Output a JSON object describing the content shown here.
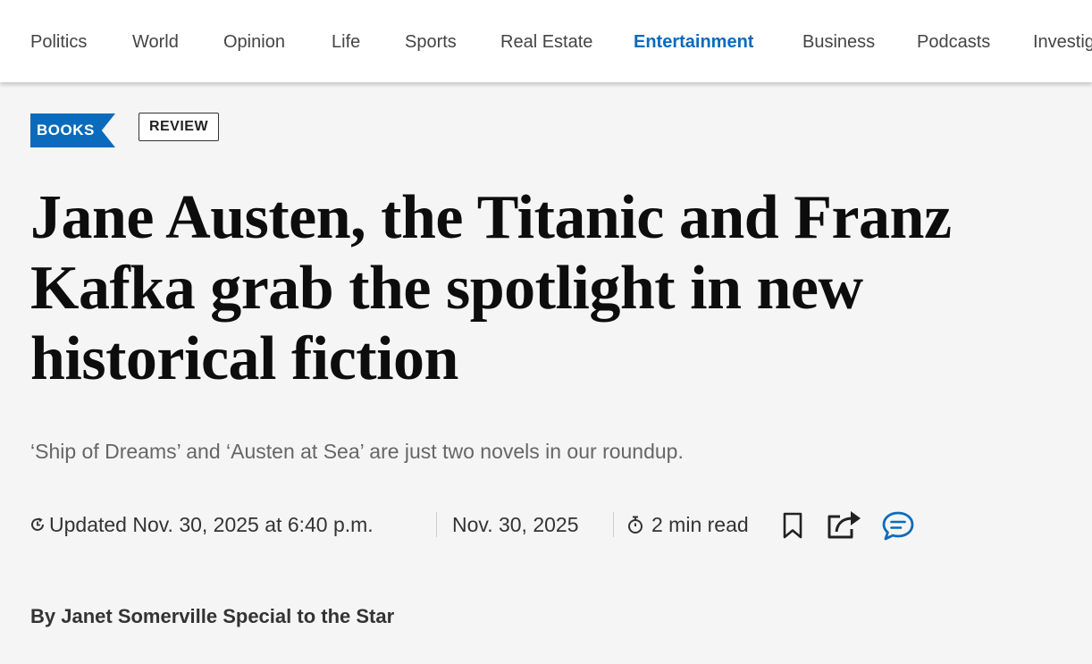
{
  "nav": {
    "items": [
      {
        "label": "Politics"
      },
      {
        "label": "World"
      },
      {
        "label": "Opinion"
      },
      {
        "label": "Life"
      },
      {
        "label": "Sports"
      },
      {
        "label": "Real Estate"
      },
      {
        "label": "Entertainment",
        "active": true
      },
      {
        "label": "Business"
      },
      {
        "label": "Podcasts"
      },
      {
        "label": "Investig"
      }
    ]
  },
  "article": {
    "section_tag": "BOOKS",
    "type_tag": "REVIEW",
    "headline_lines": [
      "Jane Austen, the Titanic and Franz",
      "Kafka grab the spotlight in new",
      "historical fiction"
    ],
    "dek": "‘Ship of Dreams’ and ‘Austen at Sea’ are just two novels in our roundup.",
    "meta": {
      "updated": "Updated Nov. 30, 2025 at 6:40 p.m.",
      "published": "Nov. 30, 2025",
      "read_time": "2 min read"
    },
    "byline": "By Janet Somerville Special to the Star"
  },
  "icons": {
    "updated": "refresh-clock-icon",
    "read_time": "stopwatch-icon",
    "bookmark": "bookmark-icon",
    "share": "share-icon",
    "comments": "comment-icon"
  },
  "colors": {
    "accent": "#0a6bbd",
    "nav_text": "#444444",
    "page_bg": "#f5f5f5",
    "headline": "#0d0d0d",
    "dek": "#666666",
    "meta": "#333333"
  }
}
